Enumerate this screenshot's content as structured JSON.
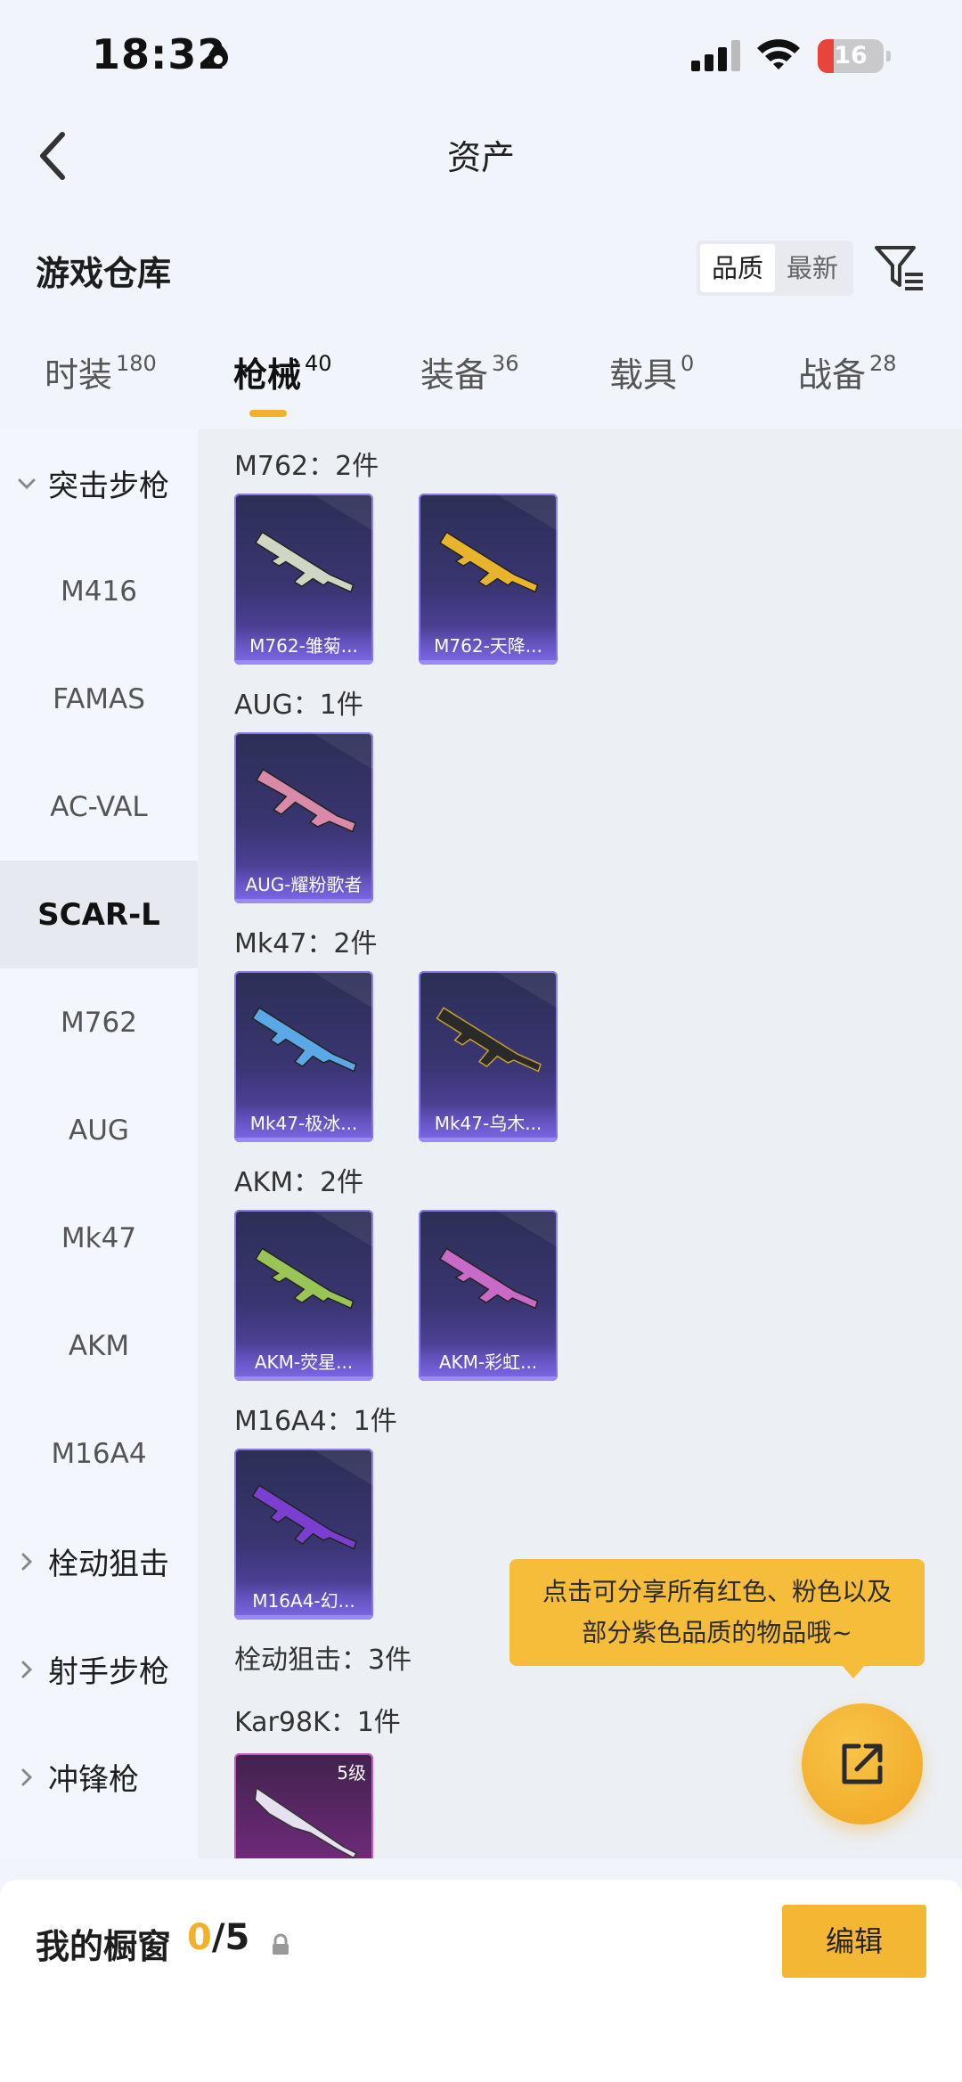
{
  "status_bar": {
    "time": "18:32",
    "battery": "16",
    "battery_level": 0.16
  },
  "nav": {
    "title": "资产"
  },
  "header": {
    "title": "游戏仓库",
    "sort_options": [
      "品质",
      "最新"
    ],
    "sort_selected": "品质"
  },
  "tabs": [
    {
      "label": "时装",
      "count": "180",
      "active": false
    },
    {
      "label": "枪械",
      "count": "40",
      "active": true
    },
    {
      "label": "装备",
      "count": "36",
      "active": false
    },
    {
      "label": "载具",
      "count": "0",
      "active": false
    },
    {
      "label": "战备",
      "count": "28",
      "active": false
    }
  ],
  "sidebar": {
    "items": [
      {
        "label": "突击步枪",
        "type": "group",
        "expanded": true
      },
      {
        "label": "M416",
        "type": "item"
      },
      {
        "label": "FAMAS",
        "type": "item"
      },
      {
        "label": "AC-VAL",
        "type": "item"
      },
      {
        "label": "SCAR-L",
        "type": "item",
        "selected": true
      },
      {
        "label": "M762",
        "type": "item"
      },
      {
        "label": "AUG",
        "type": "item"
      },
      {
        "label": "Mk47",
        "type": "item"
      },
      {
        "label": "AKM",
        "type": "item"
      },
      {
        "label": "M16A4",
        "type": "item"
      },
      {
        "label": "栓动狙击",
        "type": "group",
        "expanded": false
      },
      {
        "label": "射手步枪",
        "type": "group",
        "expanded": false
      },
      {
        "label": "冲锋枪",
        "type": "group",
        "expanded": false
      }
    ]
  },
  "content": {
    "groups": [
      {
        "label": "M762：2件",
        "cards": [
          {
            "name": "M762-雏菊...",
            "gun_color": "#cfd6c4"
          },
          {
            "name": "M762-天降...",
            "gun_color": "#e7b42c"
          }
        ]
      },
      {
        "label": "AUG：1件",
        "cards": [
          {
            "name": "AUG-耀粉歌者",
            "gun_color": "#d98aa8"
          }
        ]
      },
      {
        "label": "Mk47：2件",
        "cards": [
          {
            "name": "Mk47-极冰...",
            "gun_color": "#5aa8e6"
          },
          {
            "name": "Mk47-乌木...",
            "gun_color": "#2a2a2a"
          }
        ]
      },
      {
        "label": "AKM：2件",
        "cards": [
          {
            "name": "AKM-荧星...",
            "gun_color": "#9ac456"
          },
          {
            "name": "AKM-彩虹...",
            "gun_color": "#c86ac8"
          }
        ]
      },
      {
        "label": "M16A4：1件",
        "cards": [
          {
            "name": "M16A4-幻...",
            "gun_color": "#7a3fd0"
          }
        ]
      },
      {
        "label": "栓动狙击：3件",
        "cards": []
      },
      {
        "label": "Kar98K：1件",
        "cards": [
          {
            "name": "",
            "level": "5级",
            "gun_color": "#e6e0f0",
            "pink": true
          }
        ]
      }
    ]
  },
  "tooltip": {
    "line1": "点击可分享所有红色、粉色以及",
    "line2": "部分紫色品质的物品哦~"
  },
  "bottom": {
    "title": "我的橱窗",
    "count_current": "0",
    "count_total": "/5",
    "edit_label": "编辑"
  },
  "colors": {
    "accent": "#f2b12c",
    "card_purple": "#5d4ab6",
    "background": "#f1f4fa"
  }
}
